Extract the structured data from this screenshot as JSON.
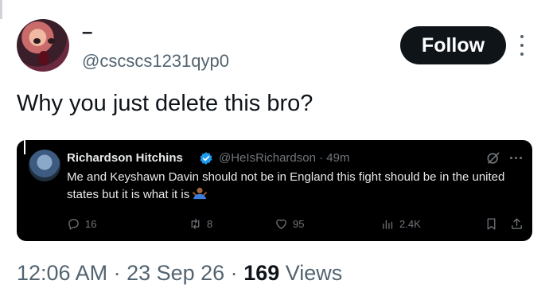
{
  "author": {
    "display_name": "–",
    "handle": "@cscscs1231qyp0"
  },
  "follow_label": "Follow",
  "tweet_text": "Why you just delete this bro?",
  "quoted": {
    "name": "Richardson Hitchins",
    "meta": "@HeIsRichardson · 49m",
    "text": "Me and Keyshawn Davin should not be in England this fight should be in the united states but it is what it is",
    "metrics": {
      "replies": "16",
      "reposts": "8",
      "likes": "95",
      "views": "2.4K"
    }
  },
  "timestamp": {
    "time_date": "12:06 AM · 23 Sep 26 · ",
    "views_count": "169",
    "views_label": " Views"
  },
  "colors": {
    "verified": "#1d9bf0",
    "follow_bg": "#0f1419",
    "muted": "#536471"
  }
}
